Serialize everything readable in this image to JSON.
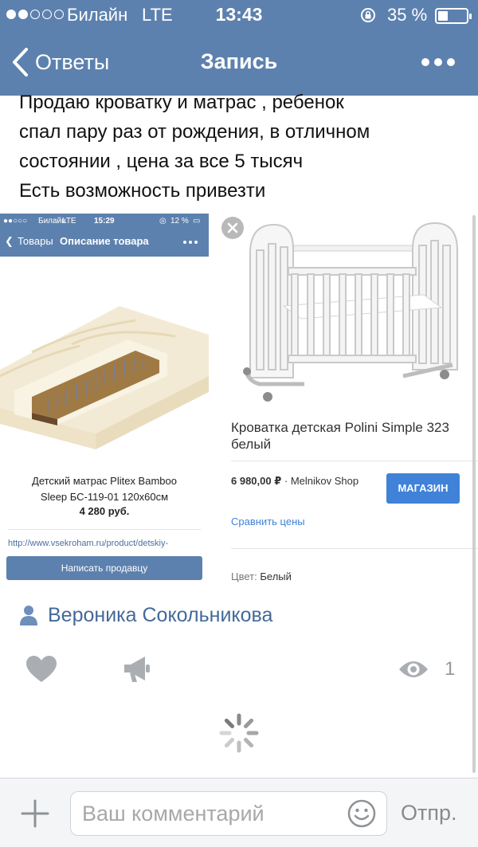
{
  "status_bar": {
    "carrier": "Билайн",
    "network": "LTE",
    "time": "13:43",
    "battery_pct": "35 %",
    "signal_bars": 2,
    "battery_level": 0.35
  },
  "nav": {
    "back_label": "Ответы",
    "title": "Запись"
  },
  "post": {
    "lines": [
      "Продаю кроватку и матрас , ребенок",
      "спал пару раз от рождения, в отличном",
      "состоянии , цена за все 5 тысяч",
      "Есть возможность привезти"
    ]
  },
  "attachment_left": {
    "status": {
      "carrier": "Билайн",
      "network": "LTE",
      "time": "15:29",
      "battery_pct": "12 %"
    },
    "nav_back": "Товары",
    "nav_title": "Описание товара",
    "product_name_1": "Детский матрас Plitex Bamboo",
    "product_name_2": "Sleep БС-119-01 120х60см",
    "price": "4 280 руб.",
    "url": "http://www.vsekroham.ru/product/detskiy-",
    "button_label": "Написать продавцу"
  },
  "attachment_right": {
    "product_name": "Кроватка детская Polini Simple 323 белый",
    "price": "6 980,00 ₽",
    "seller": " · Melnikov Shop",
    "shop_button": "МАГАЗИН",
    "compare_label": "Сравнить цены",
    "color_label": "Цвет:",
    "color_value": "Белый"
  },
  "author": {
    "name": "Вероника Сокольникова"
  },
  "actions": {
    "views_count": "1"
  },
  "composer": {
    "placeholder": "Ваш комментарий",
    "send_label": "Отпр."
  },
  "colors": {
    "header": "#5d81ae",
    "link": "#44699a",
    "shop_button": "#3f82d8"
  }
}
